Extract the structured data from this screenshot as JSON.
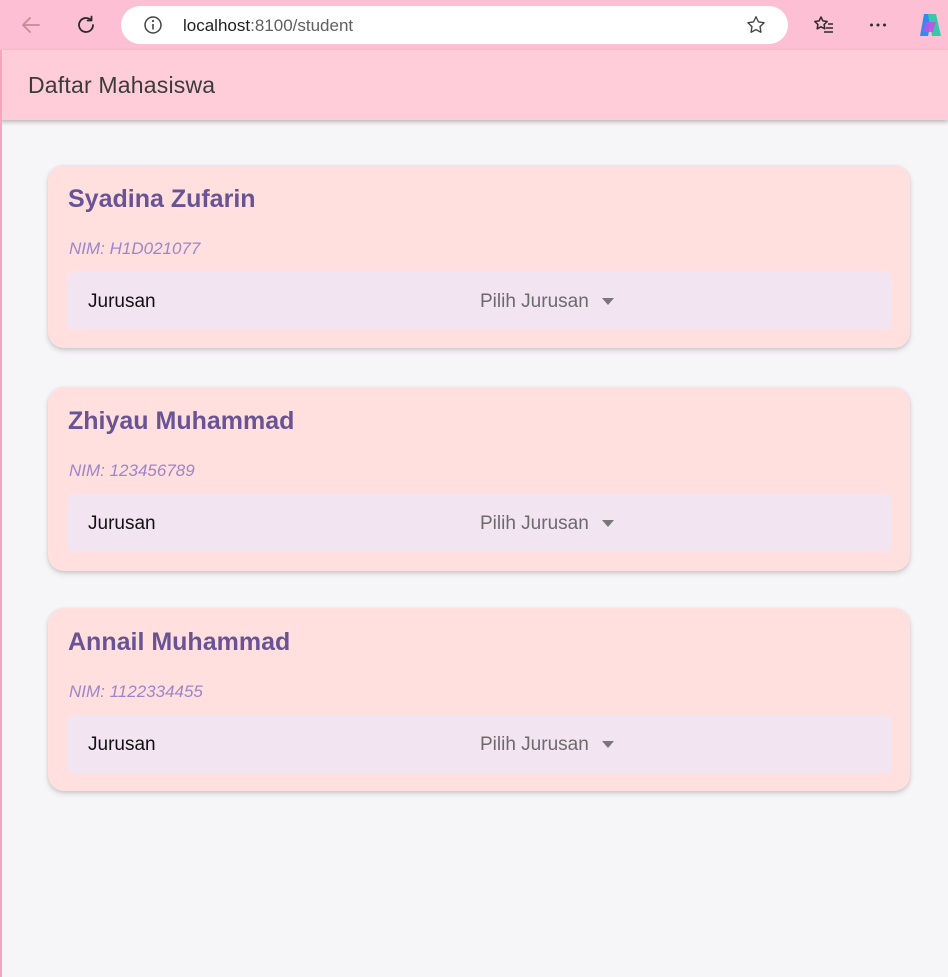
{
  "browser": {
    "url_host": "localhost",
    "url_path": ":8100/student"
  },
  "header": {
    "title": "Daftar Mahasiswa"
  },
  "students": [
    {
      "name": "Syadina Zufarin",
      "nim": "NIM: H1D021077",
      "jurusan_label": "Jurusan",
      "jurusan_placeholder": "Pilih Jurusan"
    },
    {
      "name": "Zhiyau Muhammad",
      "nim": "NIM: 123456789",
      "jurusan_label": "Jurusan",
      "jurusan_placeholder": "Pilih Jurusan"
    },
    {
      "name": "Annail Muhammad",
      "nim": "NIM: 1122334455",
      "jurusan_label": "Jurusan",
      "jurusan_placeholder": "Pilih Jurusan"
    }
  ],
  "icons": {
    "back": "back-arrow-icon",
    "reload": "reload-icon",
    "info": "info-icon",
    "favorite": "star-icon",
    "favorites_list": "favorites-icon",
    "more": "more-icon",
    "copilot": "copilot-icon"
  },
  "colors": {
    "browser_bar": "#fdbfd3",
    "toolbar": "#fecdd9",
    "card": "#ffe0df",
    "name": "#6a5395",
    "nim": "#9c86c9",
    "select_bg": "#f3e4f2"
  }
}
